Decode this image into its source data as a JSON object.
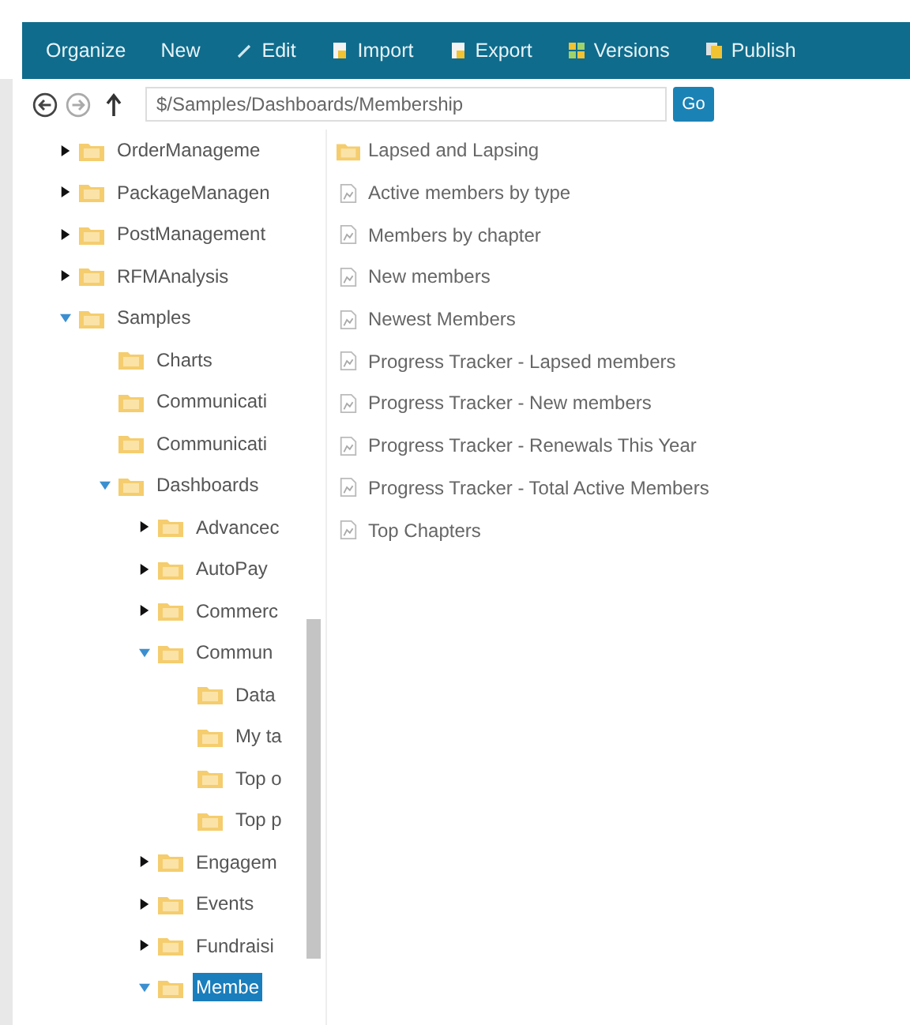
{
  "toolbar": [
    {
      "label": "Organize"
    },
    {
      "label": "New"
    },
    {
      "label": "Edit"
    },
    {
      "label": "Import"
    },
    {
      "label": "Export"
    },
    {
      "label": "Versions"
    },
    {
      "label": "Publish"
    }
  ],
  "address": {
    "value": "$/Samples/Dashboards/Membership",
    "go": "Go"
  },
  "tree": [
    {
      "label": "OrderManageme",
      "expanded": false,
      "selected": false
    },
    {
      "label": "PackageManagen",
      "expanded": false,
      "selected": false
    },
    {
      "label": "PostManagement",
      "expanded": false,
      "selected": false
    },
    {
      "label": "RFMAnalysis",
      "expanded": false,
      "selected": false
    },
    {
      "label": "Samples",
      "expanded": true,
      "selected": false,
      "children": [
        {
          "label": "Charts",
          "selected": false
        },
        {
          "label": "Communicati",
          "selected": false
        },
        {
          "label": "Communicati",
          "selected": false
        },
        {
          "label": "Dashboards",
          "expanded": true,
          "selected": false,
          "children": [
            {
              "label": "Advancec",
              "expanded": false,
              "selected": false
            },
            {
              "label": "AutoPay",
              "expanded": false,
              "selected": false
            },
            {
              "label": "Commerc",
              "expanded": false,
              "selected": false
            },
            {
              "label": "Commun",
              "expanded": true,
              "selected": false,
              "children": [
                {
                  "label": "Data",
                  "selected": false
                },
                {
                  "label": "My ta",
                  "selected": false
                },
                {
                  "label": "Top o",
                  "selected": false
                },
                {
                  "label": "Top p",
                  "selected": false
                }
              ]
            },
            {
              "label": "Engagem",
              "expanded": false,
              "selected": false
            },
            {
              "label": "Events",
              "expanded": false,
              "selected": false
            },
            {
              "label": "Fundraisi",
              "expanded": false,
              "selected": false
            },
            {
              "label": "Membe",
              "expanded": true,
              "selected": true
            }
          ]
        }
      ]
    }
  ],
  "items": [
    {
      "label": "Lapsed and Lapsing",
      "kind": "folder"
    },
    {
      "label": "Active members by type",
      "kind": "report"
    },
    {
      "label": "Members by chapter",
      "kind": "report"
    },
    {
      "label": "New members",
      "kind": "report"
    },
    {
      "label": "Newest Members",
      "kind": "report"
    },
    {
      "label": "Progress Tracker - Lapsed members",
      "kind": "report"
    },
    {
      "label": "Progress Tracker - New members",
      "kind": "report"
    },
    {
      "label": "Progress Tracker - Renewals This Year",
      "kind": "report"
    },
    {
      "label": "Progress Tracker - Total Active Members",
      "kind": "report"
    },
    {
      "label": "Top Chapters",
      "kind": "report"
    }
  ]
}
